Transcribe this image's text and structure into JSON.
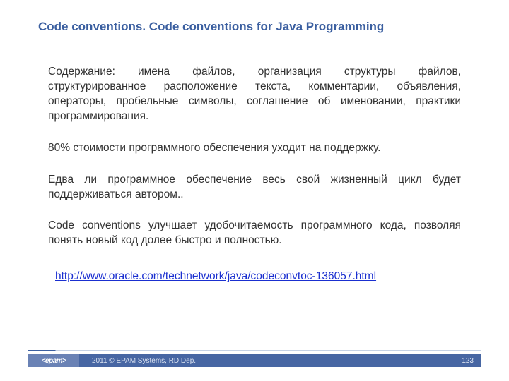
{
  "title": "Code conventions. Code conventions for Java Programming",
  "paragraphs": {
    "p1": "Содержание: имена файлов, организация структуры файлов, структурированное расположение текста, комментарии, объявления, операторы, пробельные символы, соглашение об именовании, практики программирования.",
    "p2": "80% стоимости программного обеспечения уходит на поддержку.",
    "p3": "Едва ли программное обеспечение весь свой жизненный цикл будет поддерживаться автором..",
    "p4": "Code conventions  улучшает удобочитаемость программного кода, позволяя понять новый код долее быстро и полностью."
  },
  "link": "http://www.oracle.com/technetwork/java/codeconvtoc-136057.html",
  "footer": {
    "logo": "<epam>",
    "copyright": "2011 © EPAM Systems, RD Dep.",
    "page": "123"
  }
}
